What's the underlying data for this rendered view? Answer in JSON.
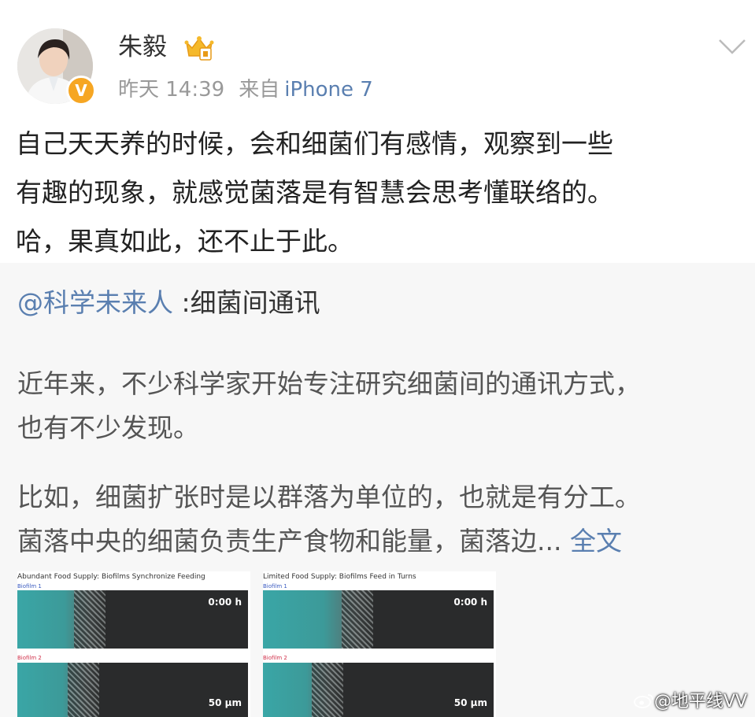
{
  "post": {
    "username": "朱毅",
    "time": "昨天 14:39",
    "source_prefix": "来自",
    "source": "iPhone 7",
    "verified_mark": "V",
    "text_lines": [
      "自己天天养的时候，会和细菌们有感情，观察到一些",
      "有趣的现象，就感觉菌落是有智慧会思考懂联络的。",
      "哈，果真如此，还不止于此。"
    ]
  },
  "repost": {
    "mention": "@科学未来人",
    "title": " :细菌间通讯",
    "para1": [
      "近年来，不少科学家开始专注研究细菌间的通讯方式，",
      "也有不少发现。"
    ],
    "para2": [
      "比如，细菌扩张时是以群落为单位的，也就是有分工。",
      "菌落中央的细菌负责生产食物和能量，菌落边..."
    ],
    "full_text_link": "全文",
    "images": [
      {
        "title": "Abundant Food Supply: Biofilms Synchronize Feeding",
        "label1": "Biofilm 1",
        "label2": "Biofilm 2",
        "time": "0:00 h",
        "scale": "50 μm"
      },
      {
        "title": "Limited Food Supply: Biofilms Feed in Turns",
        "label1": "Biofilm 1",
        "label2": "Biofilm 2",
        "time": "0:00 h",
        "scale": "50 μm"
      }
    ]
  },
  "watermark": "@地平线VV",
  "colors": {
    "link": "#5a7fb0",
    "badge": "#f6a623",
    "repost_bg": "#f7f7f7",
    "biofilm1_label": "#3b5bc0",
    "biofilm2_label": "#d0304a"
  },
  "icons": {
    "verified": "verified-badge-icon",
    "crown": "vip-crown-icon",
    "menu": "chevron-down-icon",
    "weibo": "weibo-logo-icon"
  }
}
